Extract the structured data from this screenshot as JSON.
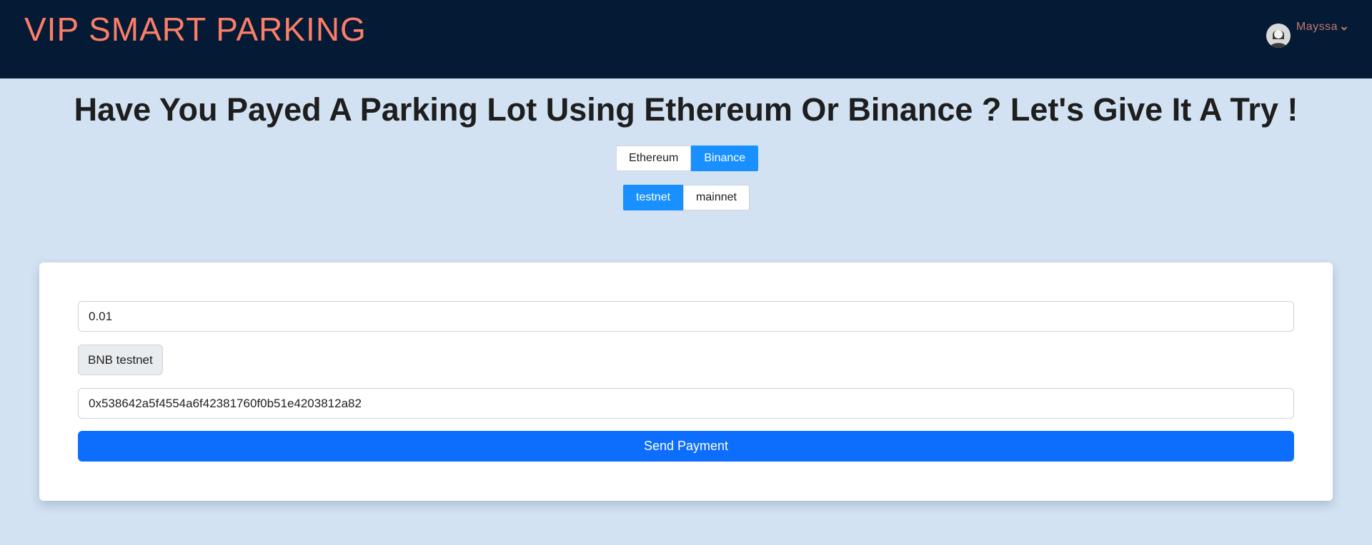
{
  "navbar": {
    "brand": "VIP SMART PARKING",
    "user_name": "Mayssa"
  },
  "headline": "Have You Payed A Parking Lot Using Ethereum Or Binance ? Let's Give It A Try !",
  "chain_toggle": {
    "options": [
      "Ethereum",
      "Binance"
    ],
    "selected": "Binance"
  },
  "network_toggle": {
    "options": [
      "testnet",
      "mainnet"
    ],
    "selected": "testnet"
  },
  "payment_form": {
    "amount_value": "0.01",
    "token_label": "BNB testnet",
    "address_value": "0x538642a5f4554a6f42381760f0b51e4203812a82",
    "send_label": "Send Payment"
  },
  "colors": {
    "navbar_bg": "#041a35",
    "brand": "#fa7e68",
    "page_bg": "#d2e2f2",
    "toggle_active": "#1890ff",
    "primary_button": "#0d6efd"
  },
  "icons": {
    "avatar": "user-avatar-icon",
    "dropdown": "chevron-down-icon"
  }
}
